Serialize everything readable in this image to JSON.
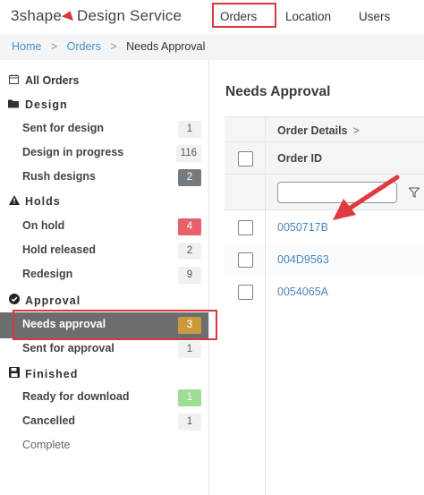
{
  "brand": {
    "name_prefix": "3shape",
    "name_suffix": "Design Service"
  },
  "nav": {
    "orders": "Orders",
    "location": "Location",
    "users": "Users"
  },
  "breadcrumb": {
    "home": "Home",
    "sep1": ">",
    "orders": "Orders",
    "sep2": ">",
    "current": "Needs Approval"
  },
  "sidebar": {
    "all_orders": "All Orders",
    "sections": {
      "design": "Design",
      "holds": "Holds",
      "approval": "Approval",
      "finished": "Finished"
    },
    "items": [
      {
        "label": "Sent for design",
        "count": "1"
      },
      {
        "label": "Design in progress",
        "count": "116"
      },
      {
        "label": "Rush designs",
        "count": "2"
      },
      {
        "label": "On hold",
        "count": "4"
      },
      {
        "label": "Hold released",
        "count": "2"
      },
      {
        "label": "Redesign",
        "count": "9"
      },
      {
        "label": "Needs approval",
        "count": "3"
      },
      {
        "label": "Sent for approval",
        "count": "1"
      },
      {
        "label": "Ready for download",
        "count": "1"
      },
      {
        "label": "Cancelled",
        "count": "1"
      },
      {
        "label": "Complete",
        "count": ""
      }
    ]
  },
  "main": {
    "title": "Needs Approval",
    "table": {
      "group_header": "Order Details",
      "group_chevron": ">",
      "col_order_id": "Order ID",
      "rows": [
        {
          "order_id": "0050717B"
        },
        {
          "order_id": "004D9563"
        },
        {
          "order_id": "0054065A"
        }
      ]
    }
  },
  "colors": {
    "highlight": "#d9373e",
    "link": "#4a86c0",
    "active_bg": "#6b6d70",
    "badge_red": "#e8616a",
    "badge_green": "#9fdc95",
    "badge_orange": "#c99a3b"
  },
  "icons": {
    "all_orders": "calendar-icon",
    "design": "folder-icon",
    "holds": "warning-icon",
    "approval": "check-circle-icon",
    "finished": "save-icon",
    "filter": "filter-icon"
  }
}
